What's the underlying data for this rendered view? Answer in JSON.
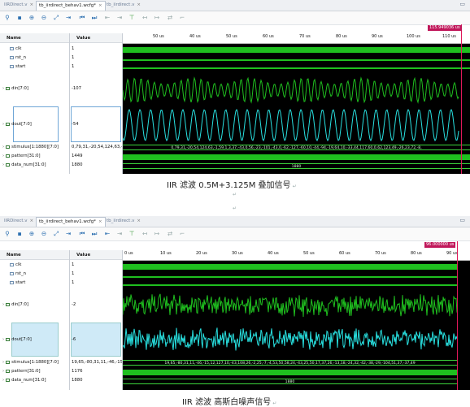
{
  "top": {
    "tabs": [
      {
        "label": "IIRDirect.v",
        "close": "×"
      },
      {
        "label": "tb_iirdirect_behav1.wcfg*",
        "close": "×"
      },
      {
        "label": "tb_iirdirect.v",
        "close": "×"
      }
    ],
    "headers": {
      "name": "Name",
      "value": "Value"
    },
    "cursor_label": "115.949036 us",
    "ticks": [
      "50 us",
      "40 us",
      "50 us",
      "60 us",
      "70 us",
      "80 us",
      "90 us",
      "100 us",
      "110 us"
    ],
    "signals": [
      {
        "name": "clk",
        "value": "1"
      },
      {
        "name": "rst_n",
        "value": "1"
      },
      {
        "name": "start",
        "value": "1"
      },
      {
        "name": "din[7:0]",
        "value": "-107"
      },
      {
        "name": "dout[7:0]",
        "value": "-54"
      },
      {
        "name": "stimulus[1:1880][7:0]",
        "value": "0,79,31,-20,54,124,63,-1,59,1,3,37"
      },
      {
        "name": "pattern[31:0]",
        "value": "1449"
      },
      {
        "name": "data_num[31:0]",
        "value": "1880"
      }
    ],
    "stimulus_wave": "0,79,31,-20,54,124,63,-1,59,1,3,37,-43,0,56,-23,-101,-43,0,-62,-127,-60,10,-44,-94,-19,64,10,-33,44,117,60,0,62,123,49,-26,23,72,-8,",
    "data_num_wave": "1880",
    "caption": "IIR  滤波  0.5M+3.125M 叠加信号",
    "caption_mark": "↵"
  },
  "mid_marks": [
    "↵",
    "↵"
  ],
  "bottom": {
    "tabs": [
      {
        "label": "IIRDirect.v",
        "close": "×"
      },
      {
        "label": "tb_iirdirect_behav1.wcfg*",
        "close": "×"
      },
      {
        "label": "tb_iirdirect.v",
        "close": "×"
      }
    ],
    "headers": {
      "name": "Name",
      "value": "Value"
    },
    "cursor_label": "96.000000 us",
    "ticks": [
      "0 us",
      "10 us",
      "20 us",
      "30 us",
      "40 us",
      "50 us",
      "60 us",
      "70 us",
      "80 us",
      "90 us"
    ],
    "signals": [
      {
        "name": "clk",
        "value": "1"
      },
      {
        "name": "rst_n",
        "value": "1"
      },
      {
        "name": "start",
        "value": "1"
      },
      {
        "name": "din[7:0]",
        "value": "-2"
      },
      {
        "name": "dout[7:0]",
        "value": "-6"
      },
      {
        "name": "stimulus[1:1880][7:0]",
        "value": "19,65,-80,31,11,-46,-15,1"
      },
      {
        "name": "pattern[31:0]",
        "value": "1176"
      },
      {
        "name": "data_num[31:0]",
        "value": "1880"
      }
    ],
    "stimulus_wave": "19,65,-80,31,11,-46,-15,12,127,10,-43,108,26,-2,25,-7,-4,53,50,58,24,-43,25,50,17,37,26,-13,18,-24,32,-42,-38,-29,-104,51,37,-37,49",
    "data_num_wave": "1880",
    "caption": "IIR  滤波  高斯白噪声信号",
    "caption_mark": "↵"
  },
  "toolbar_icons": [
    "search-icon",
    "save-icon",
    "zoom-in-icon",
    "zoom-out-icon",
    "zoom-fit-icon",
    "go-to-cursor-icon",
    "go-to-start-icon",
    "go-to-end-icon",
    "previous-transition-icon",
    "next-transition-icon",
    "add-marker-icon",
    "previous-marker-icon",
    "next-marker-icon",
    "swap-cursors-icon",
    "snap-to-transition-icon"
  ],
  "colors": {
    "wave_green": "#1fbf1f",
    "wave_cyan": "#28e0e0",
    "cursor": "#e0185a",
    "wave_bg": "#000000"
  }
}
